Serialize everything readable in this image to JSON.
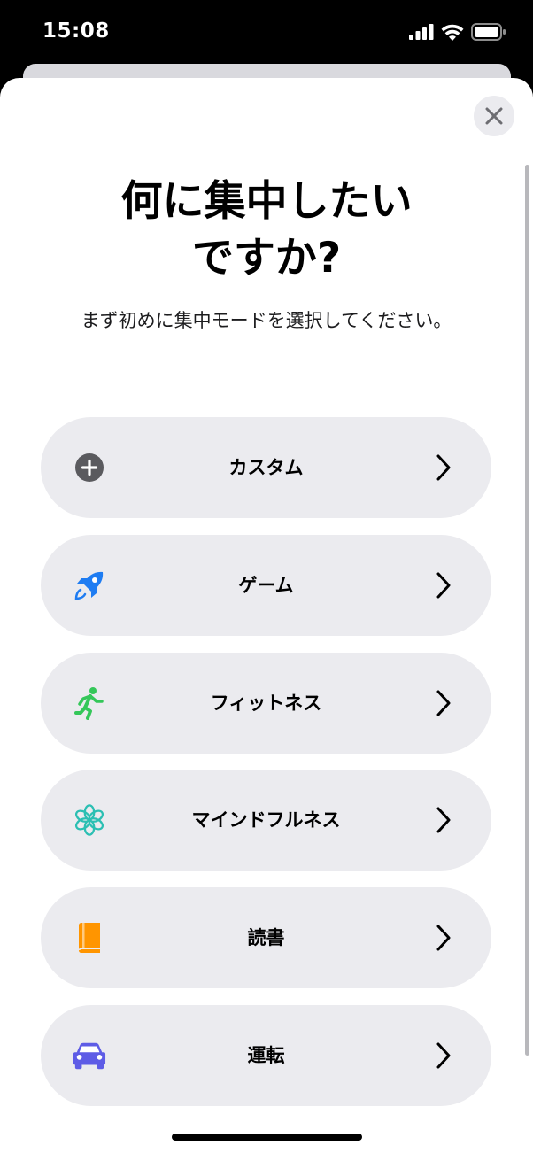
{
  "status_bar": {
    "time": "15:08"
  },
  "colors": {
    "plus": "#5a5a5e",
    "game": "#1e7cf2",
    "fitness": "#34c759",
    "mindfulness": "#2bbfb3",
    "reading": "#ff9500",
    "driving": "#5e5ce6"
  },
  "header": {
    "title_line1": "何に集中したい",
    "title_line2": "ですか?",
    "subtitle": "まず初めに集中モードを選択してください。"
  },
  "options": [
    {
      "label": "カスタム",
      "icon": "plus-circle-icon"
    },
    {
      "label": "ゲーム",
      "icon": "rocket-icon"
    },
    {
      "label": "フィットネス",
      "icon": "running-figure-icon"
    },
    {
      "label": "マインドフルネス",
      "icon": "flower-icon"
    },
    {
      "label": "読書",
      "icon": "book-icon"
    },
    {
      "label": "運転",
      "icon": "car-icon"
    }
  ]
}
